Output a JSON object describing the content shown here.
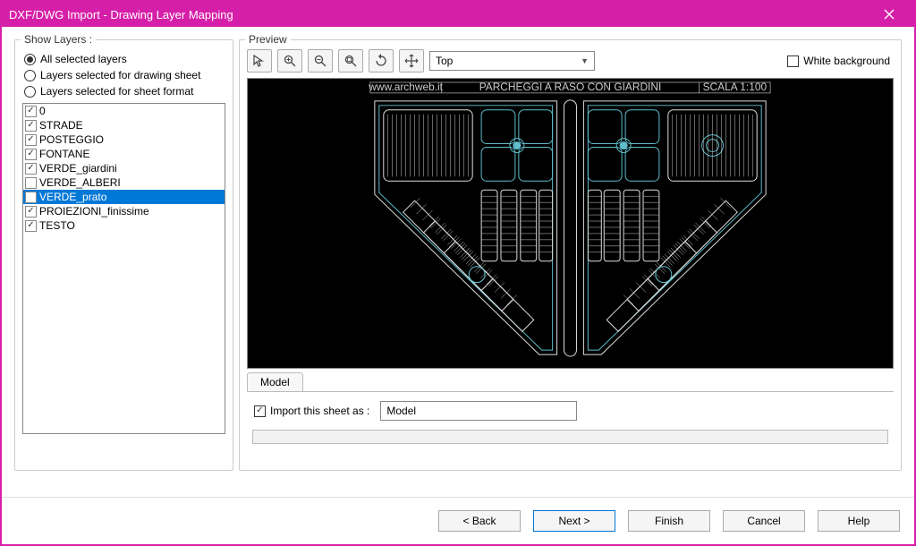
{
  "window": {
    "title": "DXF/DWG Import - Drawing Layer Mapping"
  },
  "left": {
    "legend": "Show Layers :",
    "radios": {
      "all": "All selected layers",
      "drawing": "Layers selected for drawing sheet",
      "format": "Layers selected for sheet format"
    },
    "layers": [
      {
        "label": "0",
        "checked": true,
        "selected": false
      },
      {
        "label": "STRADE",
        "checked": true,
        "selected": false
      },
      {
        "label": "POSTEGGIO",
        "checked": true,
        "selected": false
      },
      {
        "label": "FONTANE",
        "checked": true,
        "selected": false
      },
      {
        "label": "VERDE_giardini",
        "checked": true,
        "selected": false
      },
      {
        "label": "VERDE_ALBERI",
        "checked": false,
        "selected": false
      },
      {
        "label": "VERDE_prato",
        "checked": false,
        "selected": true
      },
      {
        "label": "PROIEZIONI_finissime",
        "checked": true,
        "selected": false
      },
      {
        "label": "TESTO",
        "checked": true,
        "selected": false
      }
    ]
  },
  "preview": {
    "legend": "Preview",
    "view": "Top",
    "white_bg": "White background",
    "header_left": "www.archweb.it",
    "header_center": "PARCHEGGI A RASO CON GIARDINI",
    "header_right": "SCALA 1:100"
  },
  "tabs": {
    "model": "Model"
  },
  "import": {
    "label": "Import this sheet as :",
    "value": "Model"
  },
  "buttons": {
    "back": "< Back",
    "next": "Next >",
    "finish": "Finish",
    "cancel": "Cancel",
    "help": "Help"
  },
  "icons": {
    "pick": "pick",
    "zoom_in": "zoom-in",
    "zoom_out": "zoom-out",
    "zoom_fit": "zoom-fit",
    "rotate": "rotate",
    "pan": "pan"
  }
}
